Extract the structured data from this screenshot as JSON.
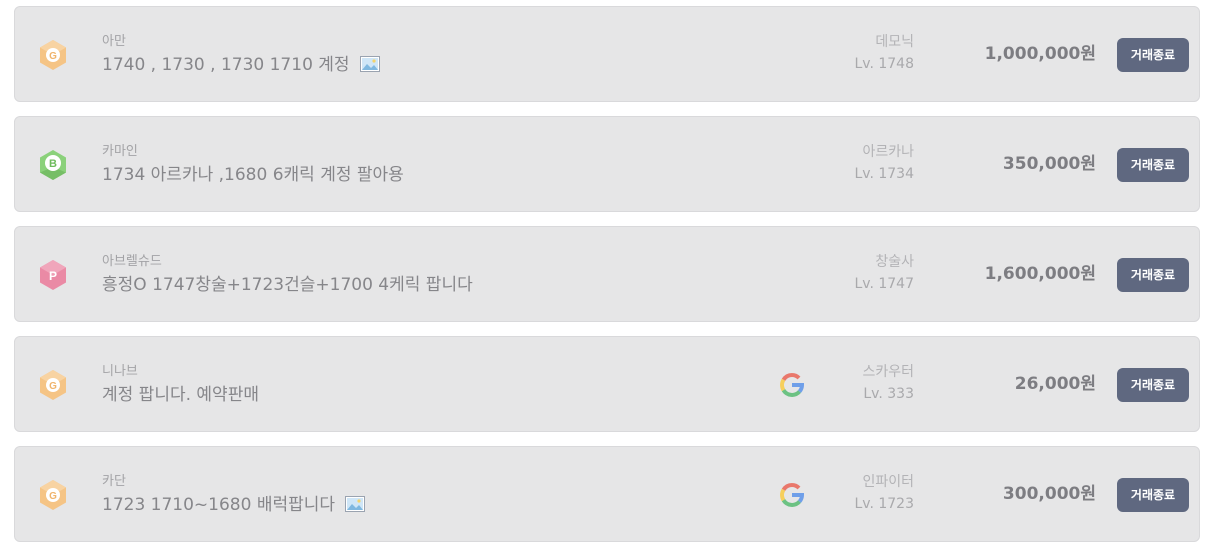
{
  "listings": [
    {
      "grade_icon": "grade-g-icon",
      "grade_letter": "G",
      "grade_color": "#f5c485",
      "server": "아만",
      "title": "1740 , 1730 , 1730 1710 계정",
      "has_image": true,
      "has_google": false,
      "class_name": "데모닉",
      "level": "Lv. 1748",
      "price": "1,000,000원",
      "status": "거래종료"
    },
    {
      "grade_icon": "grade-b-icon",
      "grade_letter": "B",
      "grade_color": "#8bd17b",
      "server": "카마인",
      "title": "1734 아르카나 ,1680 6캐릭 계정 팔아용",
      "has_image": false,
      "has_google": false,
      "class_name": "아르카나",
      "level": "Lv. 1734",
      "price": "350,000원",
      "status": "거래종료"
    },
    {
      "grade_icon": "grade-p-icon",
      "grade_letter": "P",
      "grade_color": "#ea8aa5",
      "server": "아브렐슈드",
      "title": "흥정O 1747창술+1723건슬+1700 4케릭 팝니다",
      "has_image": false,
      "has_google": false,
      "class_name": "창술사",
      "level": "Lv. 1747",
      "price": "1,600,000원",
      "status": "거래종료"
    },
    {
      "grade_icon": "grade-g-icon",
      "grade_letter": "G",
      "grade_color": "#f5c485",
      "server": "니나브",
      "title": "계정 팝니다. 예약판매",
      "has_image": false,
      "has_google": true,
      "class_name": "스카우터",
      "level": "Lv. 333",
      "price": "26,000원",
      "status": "거래종료"
    },
    {
      "grade_icon": "grade-g-icon",
      "grade_letter": "G",
      "grade_color": "#f5c485",
      "server": "카단",
      "title": "1723 1710~1680 배럭팝니다",
      "has_image": true,
      "has_google": true,
      "class_name": "인파이터",
      "level": "Lv. 1723",
      "price": "300,000원",
      "status": "거래종료"
    }
  ]
}
